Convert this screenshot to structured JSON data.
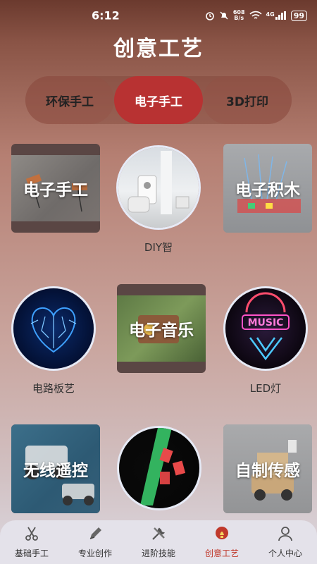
{
  "status_bar": {
    "time": "6:12",
    "net_speed_top": "608",
    "net_speed_bottom": "B/s",
    "signal_label": "4G",
    "battery": "99"
  },
  "page_title": "创意工艺",
  "tabs": [
    {
      "label": "环保手工",
      "selected": false
    },
    {
      "label": "电子手工",
      "selected": true
    },
    {
      "label": "3D打印",
      "selected": false
    }
  ],
  "grid": [
    {
      "label": "电子手工",
      "style": "square-overlay"
    },
    {
      "caption": "DIY智",
      "style": "circle"
    },
    {
      "label": "电子积木",
      "style": "square-overlay"
    },
    {
      "caption": "电路板艺",
      "style": "circle"
    },
    {
      "label": "电子音乐",
      "style": "square-overlay"
    },
    {
      "caption": "LED灯",
      "style": "circle"
    },
    {
      "label": "无线遥控",
      "style": "square-overlay"
    },
    {
      "caption": "",
      "style": "circle"
    },
    {
      "label": "自制传感",
      "style": "square-overlay"
    }
  ],
  "bottom_nav": [
    {
      "label": "基础手工",
      "icon": "scissors-icon",
      "active": false
    },
    {
      "label": "专业创作",
      "icon": "pencil-icon",
      "active": false
    },
    {
      "label": "进阶技能",
      "icon": "tools-icon",
      "active": false
    },
    {
      "label": "创意工艺",
      "icon": "lightbulb-icon",
      "active": true
    },
    {
      "label": "个人中心",
      "icon": "person-icon",
      "active": false
    }
  ],
  "colors": {
    "accent": "#b83232",
    "active_nav": "#c0392b"
  }
}
